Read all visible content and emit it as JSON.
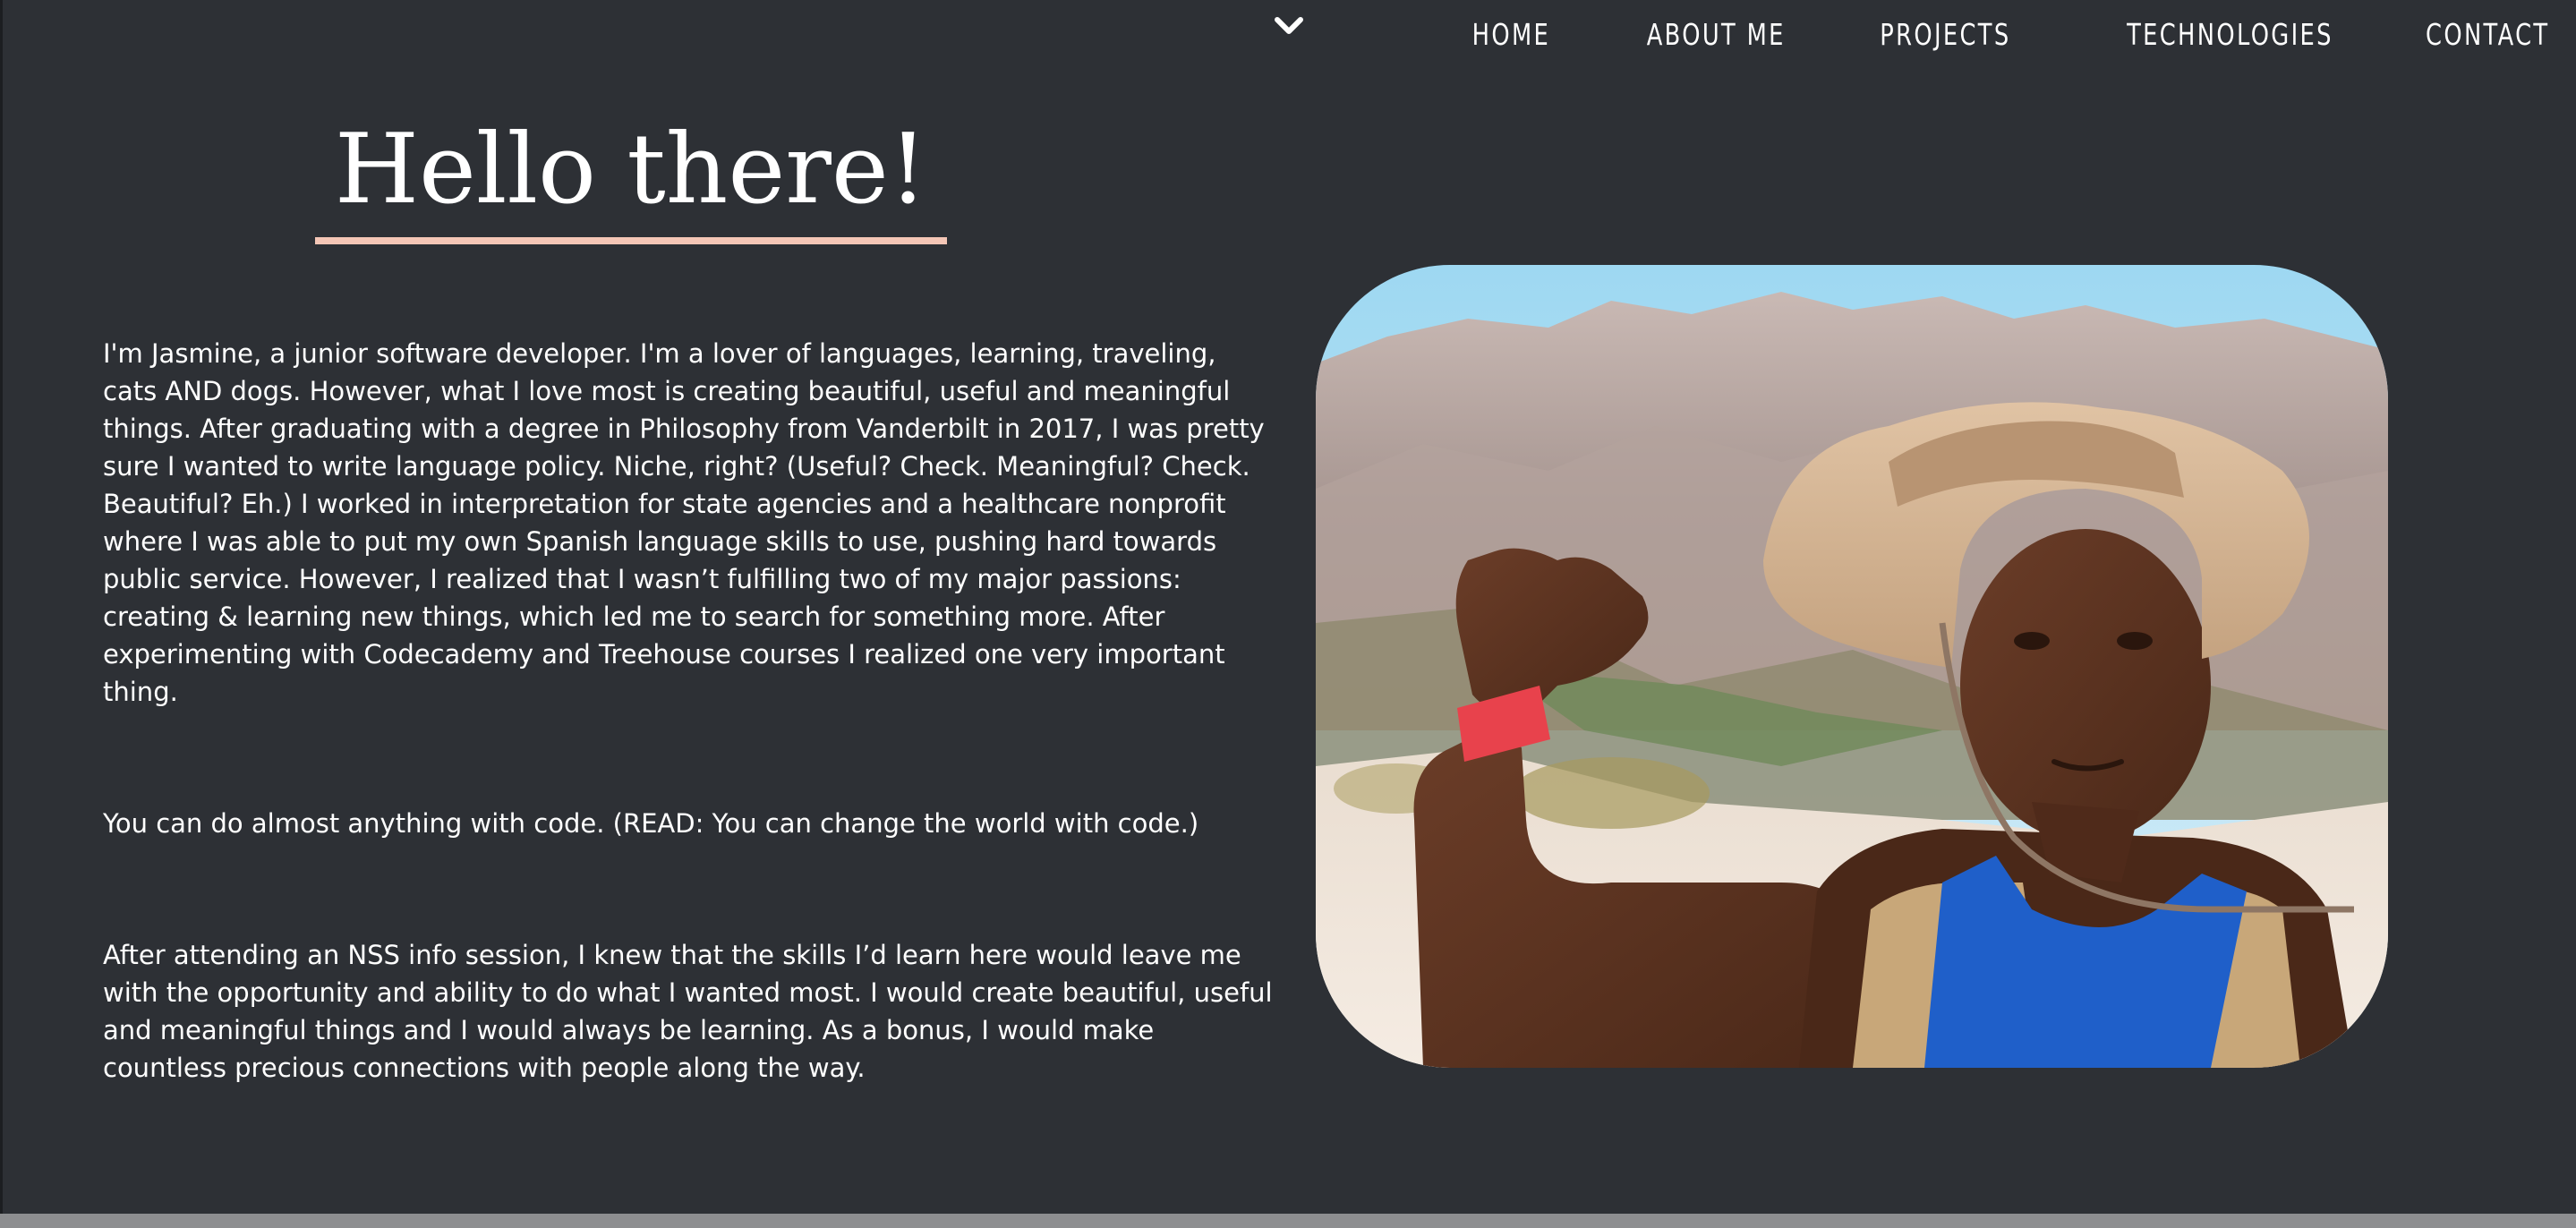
{
  "nav": {
    "scroll_icon": "chevron-down-icon",
    "items": [
      {
        "label": "HOME"
      },
      {
        "label": "ABOUT ME"
      },
      {
        "label": "PROJECTS"
      },
      {
        "label": "TECHNOLOGIES"
      },
      {
        "label": "CONTACT"
      }
    ]
  },
  "about": {
    "title": "Hello there!",
    "paragraphs": [
      "I'm Jasmine, a junior software developer. I'm a lover of languages, learning, traveling, cats AND dogs. However, what I love most is creating beautiful, useful and meaningful things. After graduating with a degree in Philosophy from Vanderbilt in 2017, I was pretty sure I wanted to write language policy. Niche, right? (Useful? Check. Meaningful? Check. Beautiful? Eh.) I worked in interpretation for state agencies and a healthcare nonprofit where I was able to put my own Spanish language skills to use, pushing hard towards public service. However, I realized that I wasn’t fulfilling two of my major passions: creating & learning new things, which led me to search for something more. After experimenting with Codecademy and Treehouse courses I realized one very important thing.",
      "You can do almost anything with code. (READ: You can change the world with code.)",
      "After attending an NSS info session, I knew that the skills I’d learn here would leave me with the opportunity and ability to do what I wanted most. I would create beautiful, useful and meaningful things and I would always be learning. As a bonus, I would make countless precious connections with people along the way."
    ],
    "photo_icon": "profile-photo"
  },
  "colors": {
    "background": "#2d3035",
    "text": "#ffffff",
    "accent_underline": "#f4c6b6",
    "bottom_bar": "#8d8e90"
  }
}
